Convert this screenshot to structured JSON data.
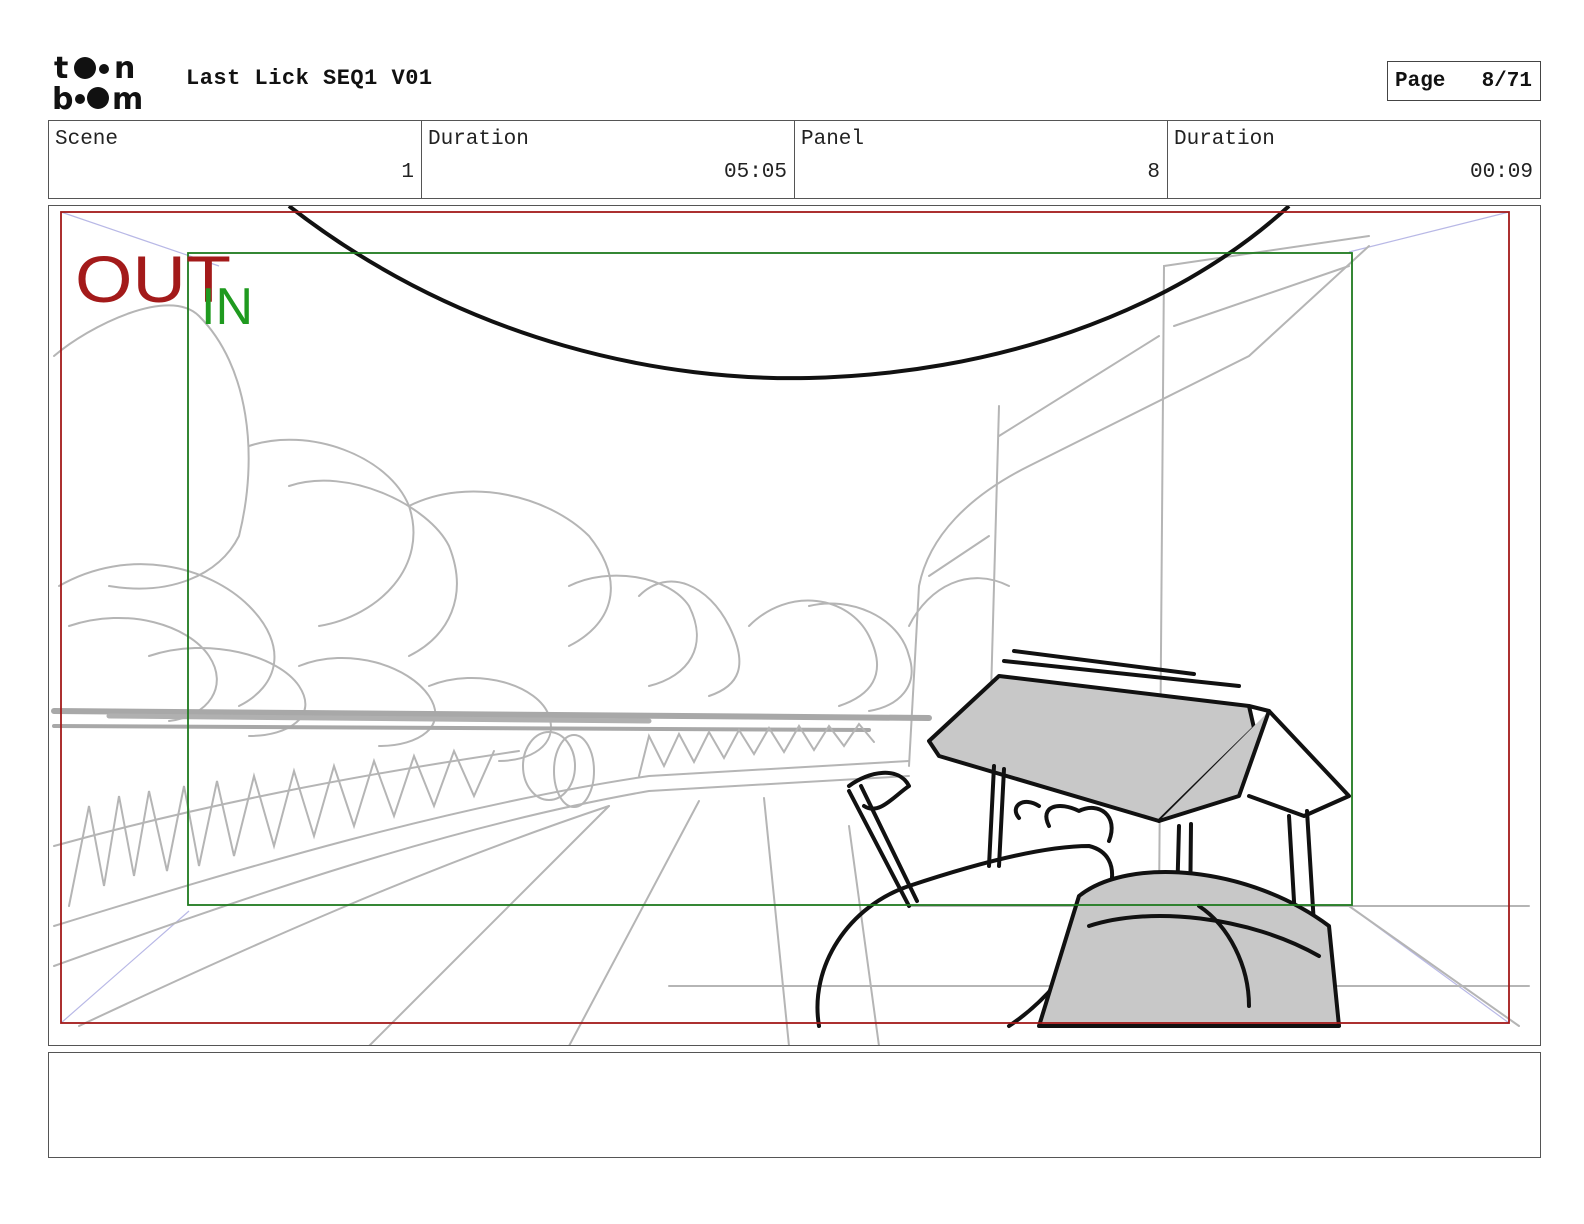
{
  "header": {
    "logo_text": "toon boom",
    "title": "Last Lick SEQ1 V01",
    "page_label": "Page",
    "page_number": "8/71"
  },
  "info": {
    "scene_label": "Scene",
    "scene_value": "1",
    "scene_duration_label": "Duration",
    "scene_duration_value": "05:05",
    "panel_label": "Panel",
    "panel_value": "8",
    "panel_duration_label": "Duration",
    "panel_duration_value": "00:09"
  },
  "panel": {
    "out_label": "OUT",
    "in_label": "IN",
    "out_color": "#a31a1a",
    "in_color": "#1f9a1f"
  },
  "notes": {
    "text": ""
  }
}
